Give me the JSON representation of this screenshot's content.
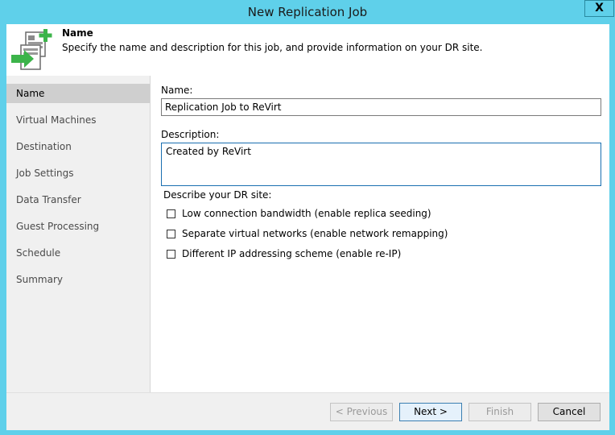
{
  "window": {
    "title": "New Replication Job",
    "close_label": "X"
  },
  "header": {
    "title": "Name",
    "description": "Specify the name and description for this job, and provide information on your DR site."
  },
  "sidebar": {
    "items": [
      {
        "label": "Name",
        "active": true
      },
      {
        "label": "Virtual Machines"
      },
      {
        "label": "Destination"
      },
      {
        "label": "Job Settings"
      },
      {
        "label": "Data Transfer"
      },
      {
        "label": "Guest Processing"
      },
      {
        "label": "Schedule"
      },
      {
        "label": "Summary"
      }
    ]
  },
  "form": {
    "name_label": "Name:",
    "name_value": "Replication Job to ReVirt",
    "description_label": "Description:",
    "description_value": "Created by ReVirt",
    "dr_label": "Describe your DR site:",
    "options": [
      {
        "label": "Low connection bandwidth (enable replica seeding)",
        "checked": false
      },
      {
        "label": "Separate virtual networks (enable network remapping)",
        "checked": false
      },
      {
        "label": "Different IP addressing scheme (enable re-IP)",
        "checked": false
      }
    ]
  },
  "footer": {
    "previous_label": "< Previous",
    "next_label": "Next >",
    "finish_label": "Finish",
    "cancel_label": "Cancel"
  },
  "colors": {
    "title_bar": "#5fd0ea",
    "accent_green": "#3cb44a",
    "active_nav": "#cfcfcf"
  }
}
